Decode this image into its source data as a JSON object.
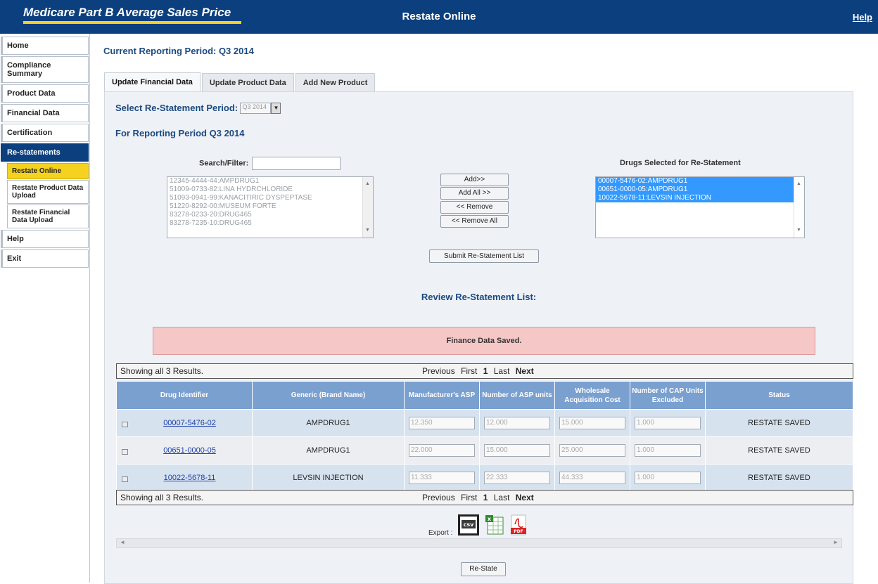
{
  "header": {
    "logo": "Medicare Part B Average Sales Price",
    "title": "Restate Online",
    "help": "Help"
  },
  "sidebar": {
    "items": [
      {
        "label": "Home"
      },
      {
        "label": "Compliance Summary"
      },
      {
        "label": "Product Data"
      },
      {
        "label": "Financial Data"
      },
      {
        "label": "Certification"
      },
      {
        "label": "Re-statements"
      }
    ],
    "sub_items": [
      {
        "label": "Restate Online"
      },
      {
        "label": "Restate Product Data Upload"
      },
      {
        "label": "Restate Financial Data Upload"
      }
    ],
    "bottom_items": [
      {
        "label": "Help"
      },
      {
        "label": "Exit"
      }
    ]
  },
  "main": {
    "period_title": "Current Reporting Period: Q3 2014",
    "tabs": [
      {
        "label": "Update Financial Data"
      },
      {
        "label": "Update Product Data"
      },
      {
        "label": "Add New Product"
      }
    ],
    "restatement_label": "Select Re-Statement Period:",
    "restatement_value": "Q3 2014",
    "for_period": "For Reporting Period Q3 2014",
    "search_label": "Search/Filter:",
    "available_list": [
      "12345-4444-44:AMPDRUG1",
      "51009-0733-82:LINA HYDRCHLORIDE",
      "51093-0941-99:KANACITIRIC DYSPEPTASE",
      "51220-8292-00:MUSEUM FORTE",
      "83278-0233-20:DRUG465",
      "83278-7235-10:DRUG465"
    ],
    "buttons": {
      "add": "Add>>",
      "add_all": "Add All >>",
      "remove": "<< Remove",
      "remove_all": "<< Remove All",
      "submit": "Submit Re-Statement List",
      "restate": "Re-State"
    },
    "selected_title": "Drugs Selected for Re-Statement",
    "selected_list": [
      "00007-5476-02:AMPDRUG1",
      "00651-0000-05:AMPDRUG1",
      "10022-5678-11:LEVSIN INJECTION"
    ],
    "review_title": "Review Re-Statement List:",
    "saved_message": "Finance Data Saved.",
    "pager": {
      "showing": "Showing all 3 Results.",
      "previous": "Previous",
      "first": "First",
      "page": "1",
      "last": "Last",
      "next": "Next"
    },
    "table": {
      "columns": [
        "Drug Identifier",
        "Generic (Brand Name)",
        "Manufacturer's ASP",
        "Number of ASP units",
        "Wholesale Acquisition Cost",
        "Number of CAP Units Excluded",
        "Status"
      ],
      "rows": [
        {
          "id": "00007-5476-02",
          "name": "AMPDRUG1",
          "asp": "12.350",
          "units": "12.000",
          "wac": "15.000",
          "cap": "1.000",
          "status": "RESTATE SAVED"
        },
        {
          "id": "00651-0000-05",
          "name": "AMPDRUG1",
          "asp": "22.000",
          "units": "15.000",
          "wac": "25.000",
          "cap": "1.000",
          "status": "RESTATE SAVED"
        },
        {
          "id": "10022-5678-11",
          "name": "LEVSIN INJECTION",
          "asp": "11.333",
          "units": "22.333",
          "wac": "44.333",
          "cap": "1.000",
          "status": "RESTATE SAVED"
        }
      ]
    },
    "export_label": "Export :",
    "export_icons": [
      "csv-icon",
      "excel-icon",
      "pdf-icon"
    ]
  }
}
